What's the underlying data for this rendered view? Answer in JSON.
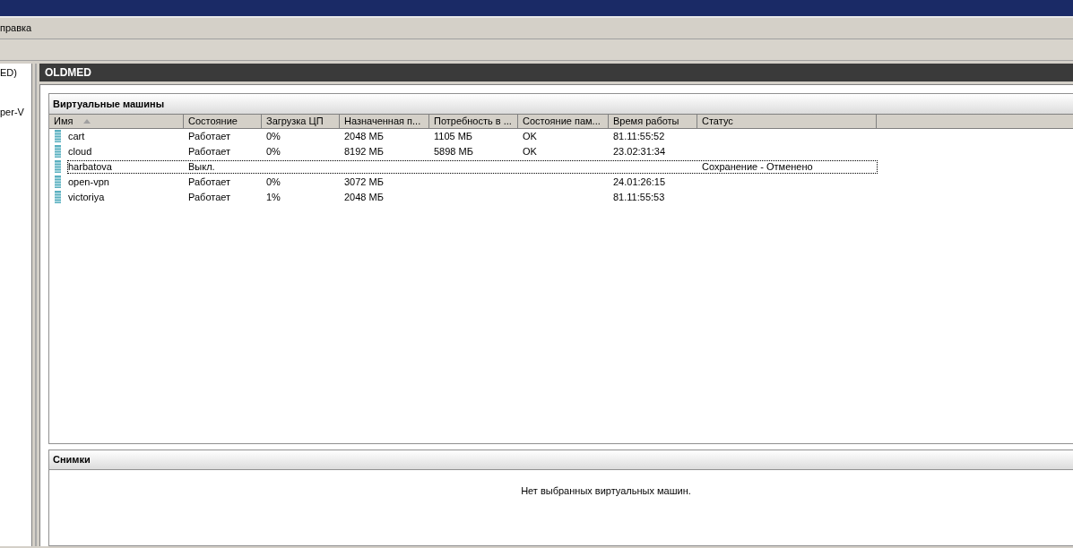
{
  "menu": [
    "правка"
  ],
  "tree": [
    {
      "label": "ED)"
    },
    {
      "label": "per-V"
    }
  ],
  "server_header": "OLDMED",
  "vm_panel": {
    "title": "Виртуальные машины",
    "columns": [
      {
        "label": "Имя",
        "sorted": true
      },
      {
        "label": "Состояние",
        "sorted": false
      },
      {
        "label": "Загрузка ЦП",
        "sorted": false
      },
      {
        "label": "Назначенная п...",
        "sorted": false
      },
      {
        "label": "Потребность в ...",
        "sorted": false
      },
      {
        "label": "Состояние пам...",
        "sorted": false
      },
      {
        "label": "Время работы",
        "sorted": false
      },
      {
        "label": "Статус",
        "sorted": false
      }
    ],
    "rows": [
      {
        "cells": [
          "cart",
          "Работает",
          "0%",
          "2048 МБ",
          "1105 МБ",
          "OK",
          "81.11:55:52",
          ""
        ],
        "focused": false
      },
      {
        "cells": [
          "cloud",
          "Работает",
          "0%",
          "8192 МБ",
          "5898 МБ",
          "OK",
          "23.02:31:34",
          ""
        ],
        "focused": false
      },
      {
        "cells": [
          "harbatova",
          "Выкл.",
          "",
          "",
          "",
          "",
          "",
          "Сохранение - Отменено"
        ],
        "focused": true
      },
      {
        "cells": [
          "open-vpn",
          "Работает",
          "0%",
          "3072 МБ",
          "",
          "",
          "24.01:26:15",
          ""
        ],
        "focused": false
      },
      {
        "cells": [
          "victoriya",
          "Работает",
          "1%",
          "2048 МБ",
          "",
          "",
          "81.11:55:53",
          ""
        ],
        "focused": false
      }
    ]
  },
  "snapshots_panel": {
    "title": "Снимки",
    "message": "Нет выбранных виртуальных машин."
  }
}
